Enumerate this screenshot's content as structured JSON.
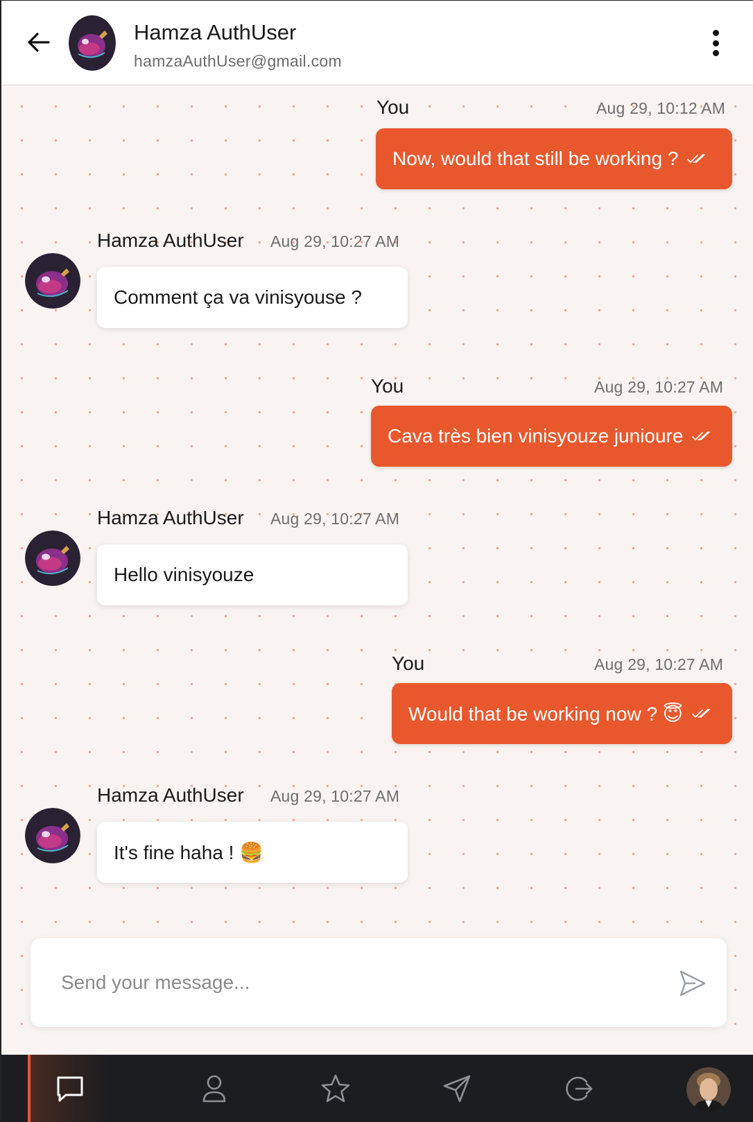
{
  "header": {
    "name": "Hamza AuthUser",
    "email": "hamzaAuthUser@gmail.com"
  },
  "messages": [
    {
      "direction": "out",
      "sender": "You",
      "time": "Aug 29, 10:12 AM",
      "text": "Now, would that still be working ?"
    },
    {
      "direction": "in",
      "sender": "Hamza AuthUser",
      "time": "Aug 29, 10:27 AM",
      "text": "Comment ça va vinisyouse ?"
    },
    {
      "direction": "out",
      "sender": "You",
      "time": "Aug 29, 10:27 AM",
      "text": "Cava très bien vinisyouze junioure"
    },
    {
      "direction": "in",
      "sender": "Hamza AuthUser",
      "time": "Aug 29, 10:27 AM",
      "text": "Hello vinisyouze"
    },
    {
      "direction": "out",
      "sender": "You",
      "time": "Aug 29, 10:27 AM",
      "text": "Would that be working now ? 😇"
    },
    {
      "direction": "in",
      "sender": "Hamza AuthUser",
      "time": "Aug 29, 10:27 AM",
      "text": "It's fine haha ! 🍔"
    }
  ],
  "composer": {
    "placeholder": "Send your message..."
  },
  "nav": {
    "items": [
      {
        "icon": "chat-icon",
        "active": true
      },
      {
        "icon": "user-icon",
        "active": false
      },
      {
        "icon": "star-icon",
        "active": false
      },
      {
        "icon": "send-icon",
        "active": false
      },
      {
        "icon": "logout-icon",
        "active": false
      },
      {
        "icon": "profile-avatar",
        "active": false
      }
    ]
  },
  "colors": {
    "accent": "#e9582d",
    "chat_background": "#f9f3f1",
    "nav_background": "#1c1d20"
  }
}
